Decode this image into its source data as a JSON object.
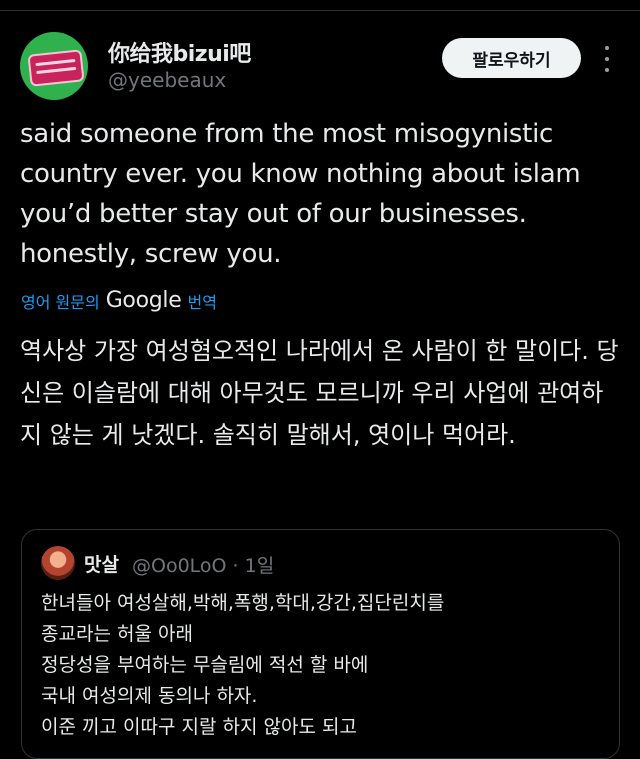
{
  "author": {
    "display_name": "你给我bizui吧",
    "handle": "@yeebeaux",
    "avatar_icon": "avatar-logo-icon"
  },
  "follow_label": "팔로우하기",
  "more_icon": "more-vertical-icon",
  "tweet": {
    "text": "said someone from the most misogynistic country ever. you know nothing about islam you’d better stay out of our businesses. honestly, screw you.",
    "translate_prefix": "영어 원문의",
    "translate_brand": "Google",
    "translate_suffix": "번역",
    "translated_text": "역사상 가장 여성혐오적인 나라에서 온 사람이 한 말이다. 당신은 이슬람에 대해 아무것도 모르니까 우리 사업에 관여하지 않는 게 낫겠다. 솔직히 말해서, 엿이나 먹어라."
  },
  "quoted": {
    "name": "맛살",
    "handle_time": "@Oo0LoO · 1일",
    "text": "한녀들아 여성살해,박해,폭행,학대,강간,집단린치를\n종교라는 허울 아래\n정당성을 부여하는 무슬림에 적선 할 바에\n국내 여성의제 동의나 하자.\n이준 끼고 이따구 지랄 하지 않아도 되고"
  },
  "colors": {
    "background": "#000000",
    "text": "#e7e9ea",
    "secondary": "#71767b",
    "link": "#1d9bf0",
    "follow_bg": "#eff3f4"
  }
}
